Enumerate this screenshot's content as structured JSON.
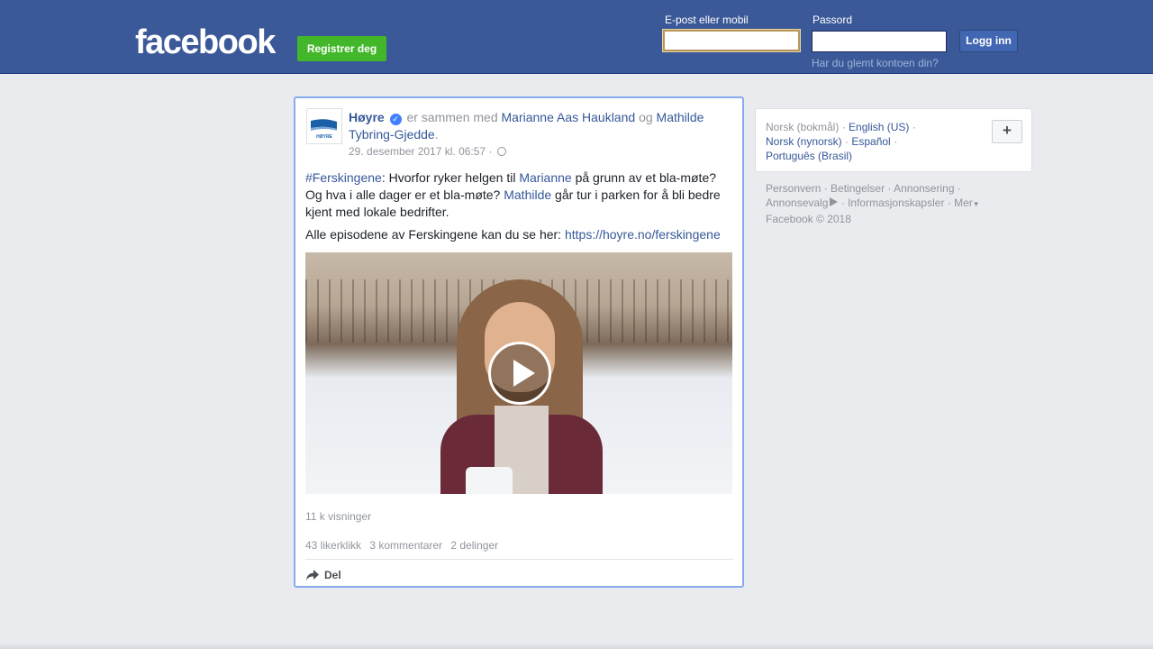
{
  "header": {
    "logo": "facebook",
    "register_label": "Registrer deg",
    "email_label": "E-post eller mobil",
    "email_value": "",
    "password_label": "Passord",
    "password_value": "",
    "login_label": "Logg inn",
    "forgot_link": "Har du glemt kontoen din?"
  },
  "post": {
    "author": "Høyre",
    "avatar_text": "HØYRE",
    "with_text": "er sammen med",
    "tagged_1": "Marianne Aas Haukland",
    "and_text": "og",
    "tagged_2": "Mathilde Tybring-Gjedde",
    "period": ".",
    "timestamp": "29. desember 2017 kl. 06:57",
    "meta_sep": "·",
    "text": {
      "hashtag": "#Ferskingene",
      "part1": ": Hvorfor ryker helgen til ",
      "mention1": "Marianne",
      "part2": " på grunn av et bla-møte? Og hva i alle dager er et bla-møte? ",
      "mention2": "Mathilde",
      "part3": " går tur i parken for å bli bedre kjent med lokale bedrifter.",
      "line2_text": "Alle episodene av Ferskingene kan du se her: ",
      "line2_link": "https://hoyre.no/ferskingene"
    },
    "views": "11 k visninger",
    "likes": "43 likerklikk",
    "comments": "3 kommentarer",
    "shares": "2 delinger",
    "share_label": "Del"
  },
  "sidebar": {
    "languages": [
      {
        "label": "Norsk (bokmål)",
        "current": true
      },
      {
        "label": "English (US)"
      },
      {
        "label": "Norsk (nynorsk)"
      },
      {
        "label": "Español"
      },
      {
        "label": "Português (Brasil)"
      }
    ],
    "sep": " · ",
    "plus_label": "+",
    "footer": {
      "privacy": "Personvern",
      "terms": "Betingelser",
      "ads": "Annonsering",
      "adchoices": "Annonsevalg",
      "cookies": "Informasjonskapsler",
      "more": "Mer",
      "copyright": "Facebook © 2018"
    }
  },
  "colors": {
    "brand": "#3b5998",
    "register": "#42b72a",
    "link": "#365899",
    "highlight_border": "#88aaee"
  },
  "icons": [
    "verified-icon",
    "globe-icon",
    "play-icon",
    "share-arrow-icon",
    "adchoices-icon",
    "caret-down-icon",
    "plus-icon"
  ]
}
